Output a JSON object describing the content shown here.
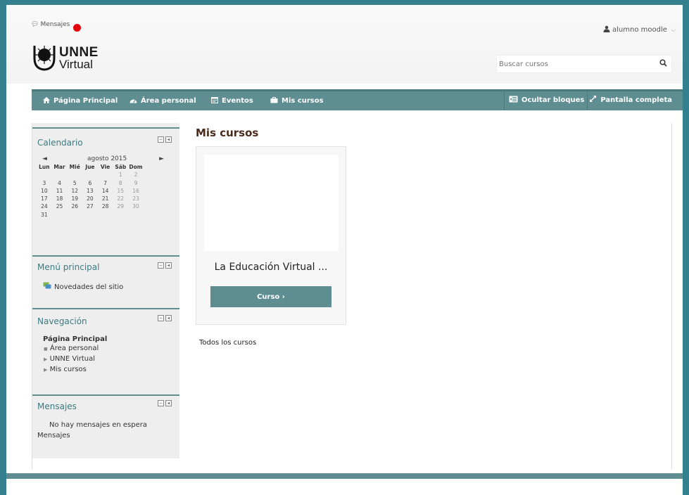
{
  "header": {
    "messages_label": "Mensajes",
    "user_name": "alumno moodle",
    "logo_line1": "UNNE",
    "logo_line2": "Virtual",
    "search_placeholder": "Buscar cursos"
  },
  "navbar": {
    "items": [
      {
        "label": "Página Principal",
        "icon": "home-icon"
      },
      {
        "label": "Área personal",
        "icon": "dashboard-icon"
      },
      {
        "label": "Eventos",
        "icon": "calendar-icon"
      },
      {
        "label": "Mis cursos",
        "icon": "briefcase-icon"
      }
    ],
    "hide_blocks": "Ocultar bloques",
    "fullscreen": "Pantalla completa"
  },
  "calendar": {
    "title": "Calendario",
    "month": "agosto 2015",
    "weekdays": [
      "Lun",
      "Mar",
      "Mié",
      "Jue",
      "Vie",
      "Sáb",
      "Dom"
    ],
    "weeks": [
      [
        "",
        "",
        "",
        "",
        "",
        "1",
        "2"
      ],
      [
        "3",
        "4",
        "5",
        "6",
        "7",
        "8",
        "9"
      ],
      [
        "10",
        "11",
        "12",
        "13",
        "14",
        "15",
        "16"
      ],
      [
        "17",
        "18",
        "19",
        "20",
        "21",
        "22",
        "23"
      ],
      [
        "24",
        "25",
        "26",
        "27",
        "28",
        "29",
        "30"
      ],
      [
        "31",
        "",
        "",
        "",
        "",
        "",
        ""
      ]
    ]
  },
  "main_menu": {
    "title": "Menú principal",
    "item": "Novedades del sitio"
  },
  "navigation": {
    "title": "Navegación",
    "root": "Página Principal",
    "items": [
      "Área personal",
      "UNNE Virtual",
      "Mis cursos"
    ]
  },
  "messages_block": {
    "title": "Mensajes",
    "empty_text": "No hay mensajes en espera",
    "link": "Mensajes"
  },
  "main": {
    "title": "Mis cursos",
    "course_name": "La Educación Virtual ...",
    "course_button": "Curso ›",
    "all_courses": "Todos los cursos"
  },
  "colors": {
    "accent": "#5e8e91",
    "frame": "#34808e",
    "badge": "#e5000b"
  }
}
